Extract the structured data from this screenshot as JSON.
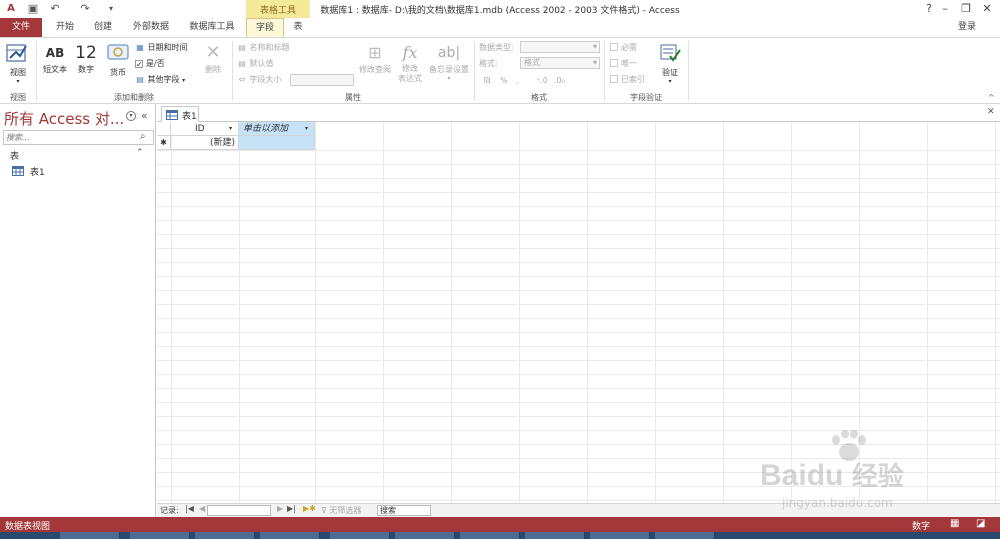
{
  "titlebar": {
    "title": "数据库1 : 数据库- D:\\我的文档\\数据库1.mdb (Access 2002 - 2003 文件格式) - Access",
    "help": "?",
    "minimize": "–",
    "restore": "❐",
    "close": "✕"
  },
  "tabs": {
    "file": "文件",
    "home": "开始",
    "create": "创建",
    "external": "外部数据",
    "dbtools": "数据库工具",
    "contextual_group": "表格工具",
    "fields": "字段",
    "table": "表",
    "signin": "登录"
  },
  "ribbon": {
    "view": {
      "label": "视图",
      "group": "视图"
    },
    "short_text": {
      "icon_text": "AB",
      "label": "短文本"
    },
    "number": {
      "icon_text": "12",
      "label": "数字"
    },
    "currency": {
      "label": "货币"
    },
    "datetime": "日期和时间",
    "yesno": "是/否",
    "more_fields": "其他字段",
    "delete": "删除",
    "add_delete_group": "添加和删除",
    "name_caption": "名称和标题",
    "default_value": "默认值",
    "field_size": "字段大小",
    "modify_lookups": "修改查阅",
    "modify_expression": "修改\n表达式",
    "memo_settings": "备忘录设置",
    "properties_group": "属性",
    "data_type_label": "数据类型:",
    "format_label": "格式:",
    "format_value": "格式",
    "format_group": "格式",
    "required": "必需",
    "unique": "唯一",
    "indexed": "已索引",
    "validation": "验证",
    "field_validation_group": "字段验证"
  },
  "navpane": {
    "title": "所有 Access 对...",
    "search_placeholder": "搜索...",
    "section": "表",
    "items": [
      {
        "label": "表1"
      }
    ]
  },
  "document": {
    "tab_label": "表1",
    "columns": [
      {
        "label": "ID"
      },
      {
        "label": "单击以添加"
      }
    ],
    "new_row_marker": "✱",
    "new_row_value": "(新建)"
  },
  "recnav": {
    "label": "记录:",
    "no_filter": "无筛选器",
    "search": "搜索"
  },
  "statusbar": {
    "left": "数据表视图",
    "numlock": "数字"
  },
  "watermark": {
    "brand": "Bai",
    "brand2": "du",
    "cn": "经验",
    "url": "jingyan.baidu.com"
  },
  "colors": {
    "accent": "#a4373a",
    "contextual": "#f5e99a",
    "selected_header": "#c6e2f7"
  }
}
